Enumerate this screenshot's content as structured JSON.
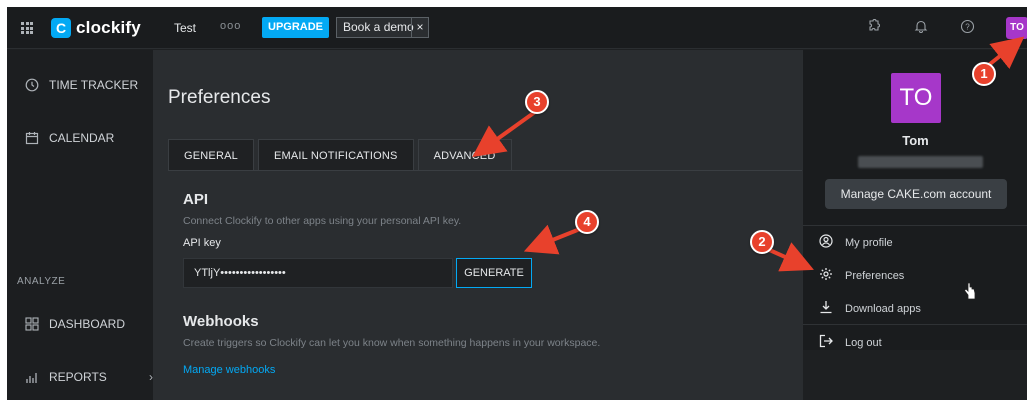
{
  "topbar": {
    "brand": "clockify",
    "workspace": "Test",
    "more": "ooo",
    "upgrade_label": "UPGRADE",
    "demo_label": "Book a demo",
    "demo_close": "×",
    "avatar_initials": "TO"
  },
  "sidebar": {
    "time_tracker": "TIME TRACKER",
    "calendar": "CALENDAR",
    "analyze_label": "ANALYZE",
    "dashboard": "DASHBOARD",
    "reports": "REPORTS"
  },
  "main": {
    "title": "Preferences",
    "tabs": [
      {
        "label": "GENERAL"
      },
      {
        "label": "EMAIL NOTIFICATIONS"
      },
      {
        "label": "ADVANCED"
      }
    ],
    "api": {
      "heading": "API",
      "description": "Connect Clockify to other apps using your personal API key.",
      "key_label": "API key",
      "key_value": "YTljY•••••••••••••••••",
      "generate_label": "GENERATE"
    },
    "webhooks": {
      "heading": "Webhooks",
      "description": "Create triggers so Clockify can let you know when something happens in your workspace.",
      "manage_link": "Manage webhooks"
    }
  },
  "dropdown": {
    "avatar_initials": "TO",
    "user_name": "Tom",
    "manage_account": "Manage CAKE.com account",
    "items": [
      {
        "label": "My profile"
      },
      {
        "label": "Preferences"
      },
      {
        "label": "Download apps"
      },
      {
        "label": "Log out"
      }
    ]
  },
  "annotations": {
    "steps": [
      "1",
      "2",
      "3",
      "4"
    ],
    "color": "#e8412c"
  },
  "colors": {
    "accent": "#03a9f4",
    "avatar": "#a637c9",
    "background": "#1e2022"
  }
}
